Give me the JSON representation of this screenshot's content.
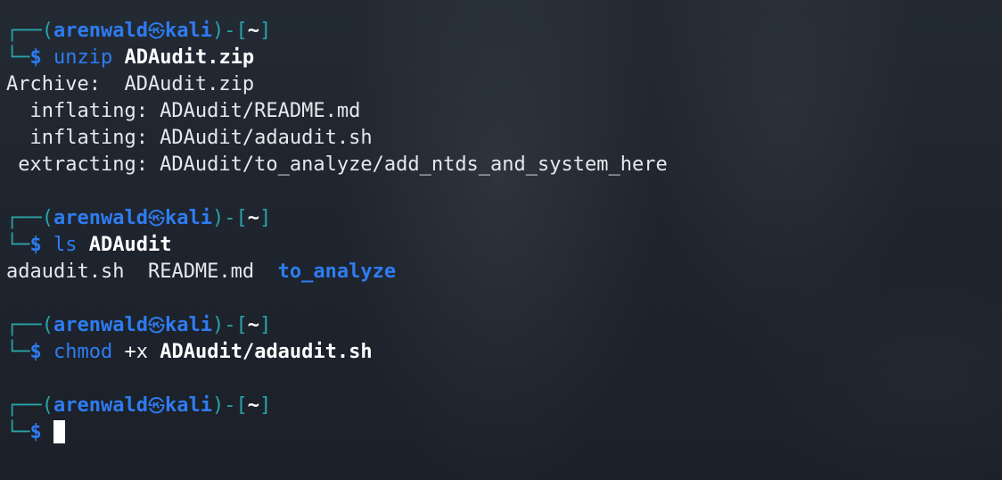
{
  "prompt": {
    "frame_open": "┌──(",
    "user": "arenwald",
    "at_symbol": "㉿",
    "host": "kali",
    "frame_mid": ")-[",
    "cwd": "~",
    "frame_close": "]",
    "frame_bottom": "└─",
    "dollar": "$"
  },
  "blocks": [
    {
      "command": "unzip",
      "args": [
        {
          "text": "ADAudit.zip",
          "bold": true
        }
      ],
      "output": [
        "Archive:  ADAudit.zip",
        "  inflating: ADAudit/README.md",
        "  inflating: ADAudit/adaudit.sh",
        " extracting: ADAudit/to_analyze/add_ntds_and_system_here"
      ]
    },
    {
      "command": "ls",
      "args": [
        {
          "text": "ADAudit",
          "bold": true
        }
      ],
      "ls_output": [
        {
          "text": "adaudit.sh",
          "dir": false
        },
        {
          "text": "README.md",
          "dir": false
        },
        {
          "text": "to_analyze",
          "dir": true
        }
      ]
    },
    {
      "command": "chmod",
      "args": [
        {
          "text": "+x",
          "bold": false
        },
        {
          "text": "ADAudit/adaudit.sh",
          "bold": true
        }
      ]
    }
  ],
  "colors": {
    "background": "#1f2530",
    "prompt_frame": "#2aa4a9",
    "prompt_blue": "#2e7cf1",
    "text": "#e6e8ec",
    "cursor": "#ffffff"
  }
}
